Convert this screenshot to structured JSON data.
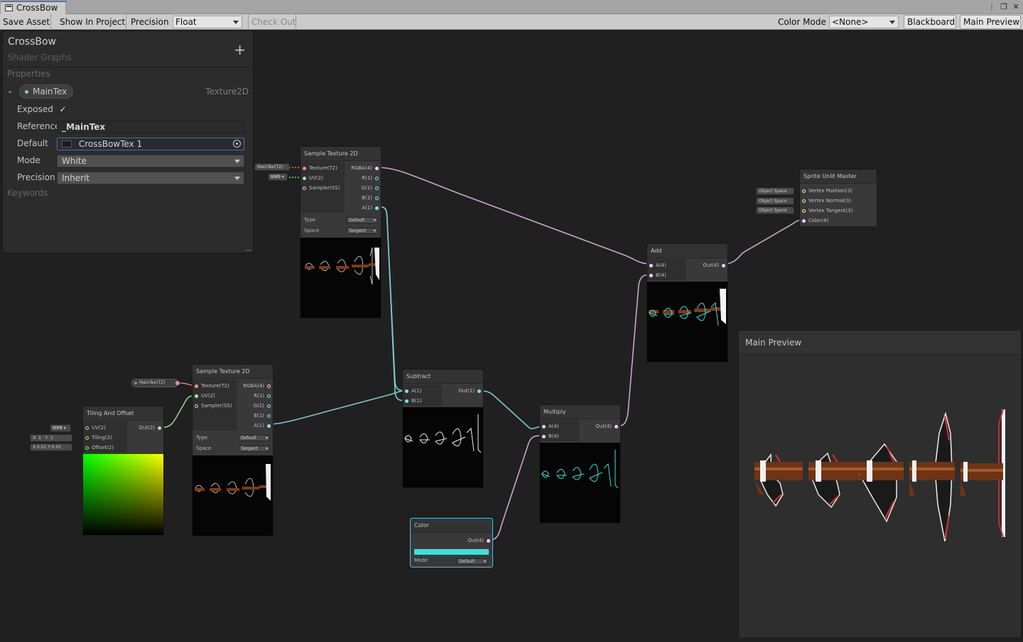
{
  "window": {
    "tab_title": "CrossBow",
    "menu_glyph": "⋮",
    "maximize_glyph": "❐",
    "close_glyph": "✕"
  },
  "toolbar": {
    "save_asset": "Save Asset",
    "show_in_project": "Show In Project",
    "precision_label": "Precision",
    "precision_value": "Float",
    "check_out": "Check Out",
    "color_mode_label": "Color Mode",
    "color_mode_value": "<None>",
    "blackboard": "Blackboard",
    "main_preview": "Main Preview"
  },
  "blackboard": {
    "title": "CrossBow",
    "subtitle": "Shader Graphs",
    "add_glyph": "+",
    "properties_header": "Properties",
    "keywords_header": "Keywords",
    "property": {
      "name": "MainTex",
      "type": "Texture2D",
      "exposed_label": "Exposed",
      "exposed_checked": true,
      "check_glyph": "✓",
      "chevron": "⌄",
      "reference_label": "Reference",
      "reference_value": "_MainTex",
      "default_label": "Default",
      "default_value": "CrossBowTex 1",
      "mode_label": "Mode",
      "mode_value": "White",
      "precision_label": "Precision",
      "precision_value": "Inherit"
    }
  },
  "nodes": {
    "sample_top": {
      "title": "Sample Texture 2D",
      "inputs": [
        "Texture(T2)",
        "UV(2)",
        "Sampler(SS)"
      ],
      "outputs": [
        "RGBA(4)",
        "R(1)",
        "G(1)",
        "B(1)",
        "A(1)"
      ],
      "type_label": "Type",
      "type_value": "Default",
      "space_label": "Space",
      "space_value": "Tangent",
      "chip_tex": "MainTex(T2)",
      "chip_uv": "UV0 ▾"
    },
    "sample_bottom": {
      "title": "Sample Texture 2D",
      "inputs": [
        "Texture(T2)",
        "UV(2)",
        "Sampler(SS)"
      ],
      "outputs": [
        "RGBA(4)",
        "R(1)",
        "G(1)",
        "B(1)",
        "A(1)"
      ],
      "type_label": "Type",
      "type_value": "Default",
      "space_label": "Space",
      "space_value": "Tangent",
      "chip_tex": "MainTex(T2)"
    },
    "tiling": {
      "title": "Tiling And Offset",
      "inputs": [
        "UV(2)",
        "Tiling(2)",
        "Offset(2)"
      ],
      "output": "Out(2)",
      "chip_uv": "UV0 ▾",
      "tiling_x_label": "X",
      "tiling_x": "1",
      "tiling_y_label": "Y",
      "tiling_y": "1",
      "offset_x_label": "X",
      "offset_x": "0.01",
      "offset_y_label": "Y",
      "offset_y": "0.01"
    },
    "subtract": {
      "title": "Subtract",
      "inputs": [
        "A(1)",
        "B(1)"
      ],
      "output": "Out(1)"
    },
    "multiply": {
      "title": "Multiply",
      "inputs": [
        "A(4)",
        "B(4)"
      ],
      "output": "Out(4)"
    },
    "color": {
      "title": "Color",
      "output": "Out(4)",
      "mode_label": "Mode",
      "mode_value": "Default",
      "swatch": "#3fe0d8"
    },
    "add": {
      "title": "Add",
      "inputs": [
        "A(4)",
        "B(4)"
      ],
      "output": "Out(4)"
    },
    "master": {
      "title": "Sprite Unlit Master",
      "inputs": [
        "Vertex Position(3)",
        "Vertex Normal(3)",
        "Vertex Tangent(3)",
        "Color(4)"
      ],
      "space_chip": "Object Space"
    }
  },
  "main_preview": {
    "title": "Main Preview"
  },
  "colors": {
    "port_vector1": "#84e4e7",
    "port_vector2": "#9aef92",
    "port_vector4": "#fbcbf4",
    "port_texture": "#ff8b8b",
    "port_vector3": "#f6ff9a",
    "wire_vector4": "#c9a6c6",
    "wire_vector1": "#7fc8c9",
    "wire_vector2": "#8fcf88",
    "selection": "#44c0ff"
  }
}
